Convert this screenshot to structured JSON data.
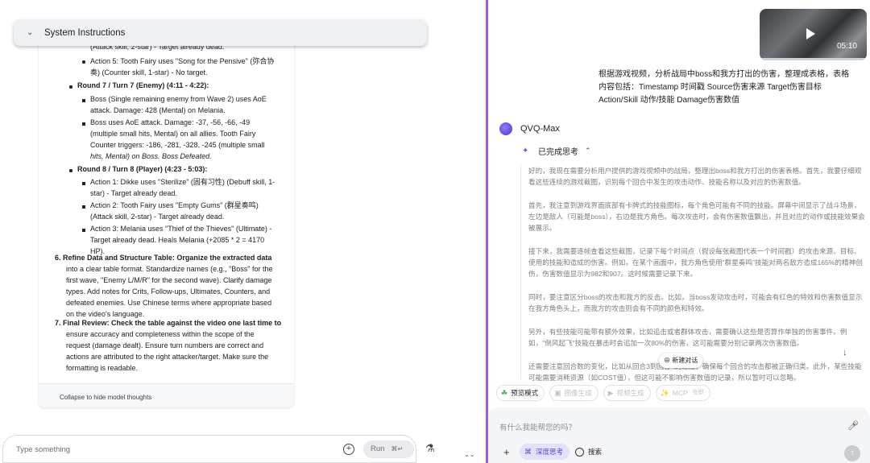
{
  "left": {
    "system_instructions_title": "System Instructions",
    "thought_lines": [
      "(Attack skill, 2-star) - Target already dead.",
      "Action 5: Tooth Fairy uses \"Song for the Pensive\" (弥合协",
      "奏) (Counter skill, 1-star) - No target.",
      "Round 7 / Turn 7 (Enemy) (4:11 - 4:22):",
      "Boss (Single remaining enemy from Wave 2) uses AoE",
      "attack. Damage: 428 (Mental) on Melania.",
      "Boss uses AoE attack. Damage: -37, -56, -66, -49",
      "(multiple small hits, Mental) on all allies. Tooth Fairy",
      "Counter triggers: -186, -281, -328, -245 (multiple small",
      "hits, Mental) on Boss. Boss Defeated.",
      "Round 8 / Turn 8 (Player) (4:23 - 5:03):",
      "Action 1: Dikke uses \"Sterilize\" (固有习性) (Debuff skill, 1-",
      "star) - Target already dead.",
      "Action 2: Tooth Fairy uses \"Empty Gums\" (群星奏鸣)",
      "(Attack skill, 2-star) - Target already dead.",
      "Action 3: Melania uses \"Thief of the Thieves\" (Ultimate) -",
      "Target already dead. Heals Melania (+2085 * 2 = 4170",
      "HP).",
      "6. Refine Data and Structure Table: Organize the extracted data",
      "into a clear table format. Standardize names (e.g., \"Boss\" for the",
      "first wave, \"Enemy L/M/R\" for the second wave). Clarify damage",
      "types. Add notes for Crits, Follow-ups, Ultimates, Counters, and",
      "defeated enemies. Use Chinese terms where appropriate based",
      "on the video's language.",
      "7. Final Review: Check the table against the video one last time to",
      "ensure accuracy and completeness within the scope of the",
      "request (damage dealt). Ensure turn numbers are correct and",
      "actions are attributed to the right attacker/target. Make sure the",
      "formatting is readable."
    ],
    "collapse_label": "Collapse to hide model thoughts",
    "input_placeholder": "Type something",
    "run_label": "Run",
    "run_shortcut": "⌘↵",
    "more_icon": "⌄⌄"
  },
  "right": {
    "video_duration": "05:10",
    "user_query": "根据游戏视频，分析战局中boss和我方打出的伤害，整理成表格，表格内容包括：Timestamp 时间戳 Source伤害来源 Target伤害目标 Action/Skill 动作/技能 Damage伤害数值",
    "bot_name": "QVQ-Max",
    "thinking_status": "已完成思考",
    "thinking_paragraphs": [
      "好的，我现在需要分析用户提供的游戏视频中的战局，整理出boss和我方打出的伤害表格。首先，我要仔细观看这些连续的游戏截图，识别每个回合中发生的攻击动作、技能名称以及对应的伤害数值。",
      "首先，我注意到游戏界面底部有卡牌式的技能图标，每个角色可能有不同的技能。屏幕中间显示了战斗场景，左边是敌人（可能是boss），右边是我方角色。每次攻击时，会有伤害数值飘出，并且对应的动作或技能效果会被展示。",
      "接下来，我需要逐帧查看这些截图，记录下每个时间点（假设每张截图代表一个时间戳）的攻击来源、目标、使用的技能和造成的伤害。例如，在某个画面中，我方角色使用\"群星奏鸣\"技能对两名敌方造成165%的精神创伤，伤害数值显示为982和907。这时候需要记录下来。",
      "同时，要注意区分boss的攻击和我方的反击。比如，当boss发动攻击时，可能会有红色的特效和伤害数值显示在我方角色头上，而我方的攻击则会有不同的颜色和特效。",
      "另外，有些技能可能带有额外效果，比如追击或者群体攻击，需要确认这些是否算作单独的伤害事件。例如，\"倒风起飞\"技能在暴击时会追加一次80%的伤害，这可能需要分别记录两次伤害数值。",
      "还需要注意回合数的变化，比如从回合3到回合4的过渡，确保每个回合的攻击都被正确归类。此外，某些技能可能需要消耗资源（如COST值），但这可能不影响伤害数值的记录，所以暂时可以忽略。"
    ],
    "new_chat_label": "新建对话",
    "chips": [
      {
        "label": "预览模式",
        "state": "active"
      },
      {
        "label": "图像生成",
        "state": "disabled"
      },
      {
        "label": "视频生成",
        "state": "disabled"
      },
      {
        "label": "MCP",
        "state": "disabled",
        "extra": "在即"
      }
    ],
    "composer_placeholder": "有什么我能帮您的吗？",
    "deep_think_label": "深度思考",
    "search_label": "搜索"
  },
  "colors": {
    "divider": "#a45bd2",
    "accent": "#5445d0",
    "accent_bg": "#e3e1fb"
  }
}
